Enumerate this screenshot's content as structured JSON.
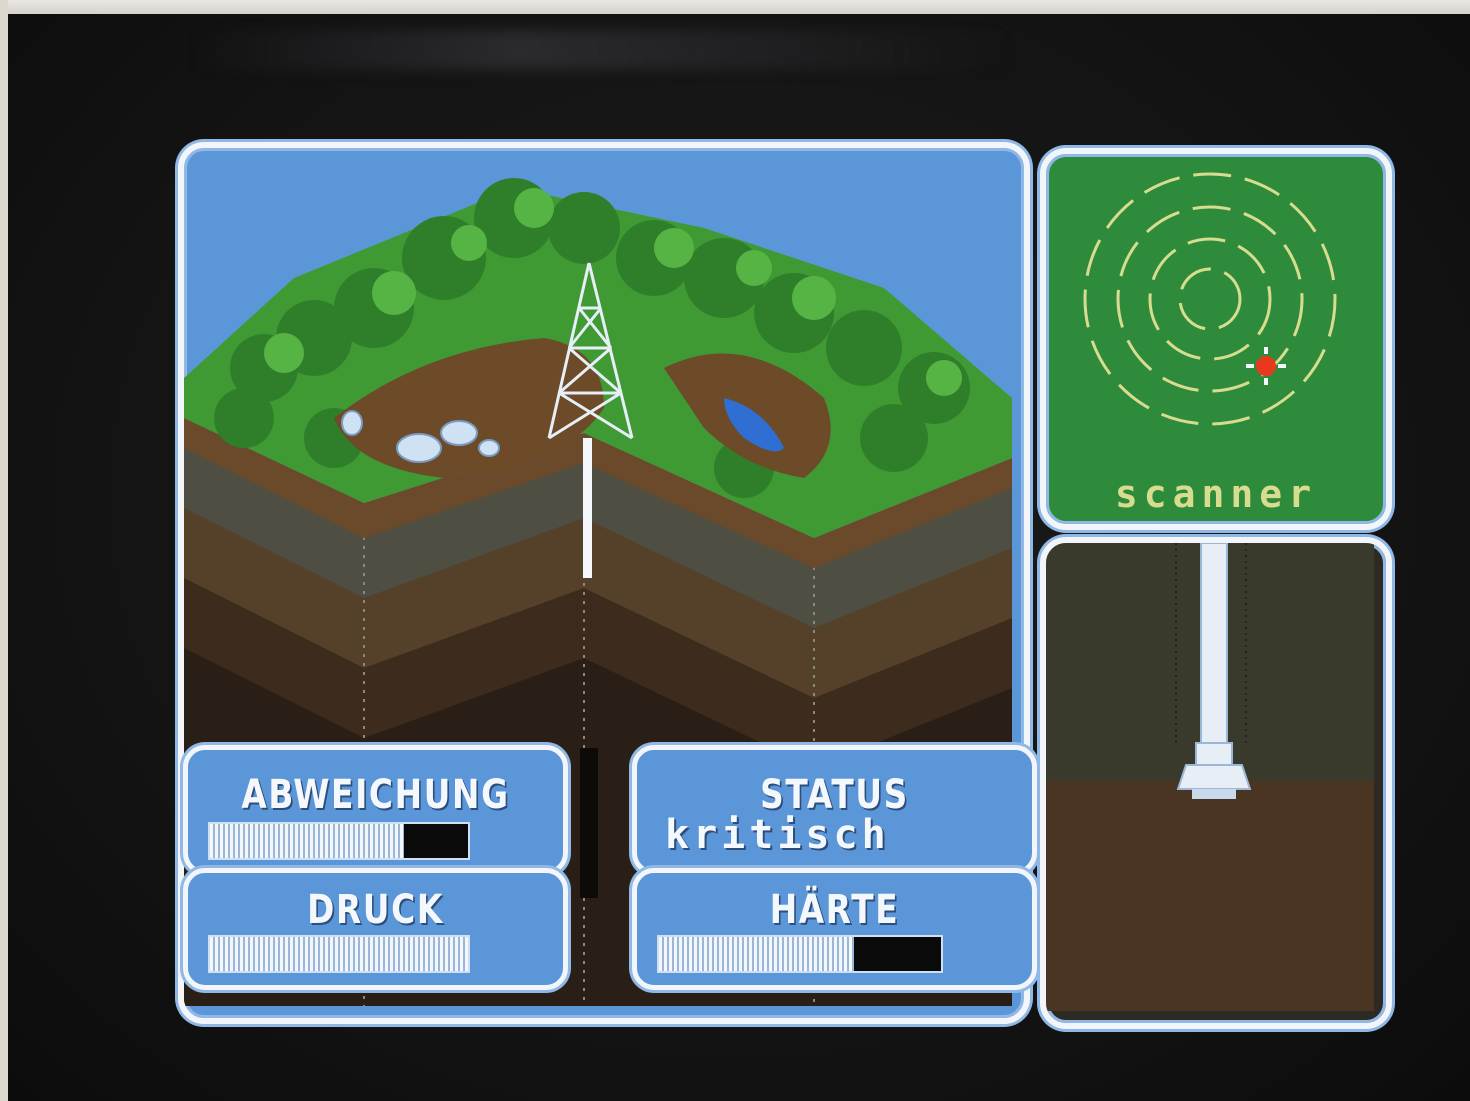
{
  "scanner": {
    "label": "scanner"
  },
  "gauges": {
    "abweichung": {
      "label": "ABWEICHUNG",
      "fill_fraction": 0.75
    },
    "status": {
      "label": "STATUS",
      "value": "kritisch"
    },
    "druck": {
      "label": "DRUCK",
      "fill_fraction": 1.0
    },
    "haerte": {
      "label": "HÄRTE",
      "fill_fraction": 0.69
    }
  },
  "colors": {
    "sky": "#5b97d8",
    "panel_border": "#f2f6fb",
    "scanner_bg": "#2f8b3c",
    "scanner_rings": "#d7dc8e",
    "target_marker": "#e8391c"
  }
}
